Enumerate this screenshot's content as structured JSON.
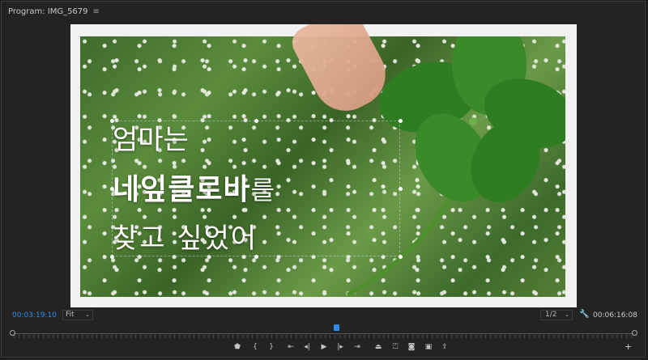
{
  "panel": {
    "title": "Program: IMG_5679",
    "menu_icon": "hamburger-menu-icon"
  },
  "viewer": {
    "title_lines": {
      "line1": "엄마는",
      "line2_bold": "네잎클로바",
      "line2_thin": "를",
      "line3": "찾고 싶었어"
    }
  },
  "controls": {
    "current_timecode": "00:03:19:10",
    "zoom_level": "Fit",
    "resolution": "1/2",
    "settings_icon": "wrench-icon",
    "duration_timecode": "00:06:16:08"
  },
  "timeline": {
    "playhead_position": 0.52
  },
  "transport": {
    "buttons": [
      {
        "name": "add-marker-icon",
        "glyph": "⬟"
      },
      {
        "name": "mark-in-icon",
        "glyph": "{"
      },
      {
        "name": "mark-out-icon",
        "glyph": "}"
      },
      {
        "name": "go-to-in-icon",
        "glyph": "⇤"
      },
      {
        "name": "step-back-icon",
        "glyph": "◂|"
      },
      {
        "name": "play-icon",
        "glyph": "▶"
      },
      {
        "name": "step-forward-icon",
        "glyph": "|▸"
      },
      {
        "name": "go-to-out-icon",
        "glyph": "⇥"
      },
      {
        "name": "lift-icon",
        "glyph": "⏏"
      },
      {
        "name": "extract-icon",
        "glyph": "⏍"
      },
      {
        "name": "export-frame-icon",
        "glyph": "◙"
      },
      {
        "name": "comparison-view-icon",
        "glyph": "▣"
      },
      {
        "name": "share-icon",
        "glyph": "⇪"
      }
    ],
    "add_button_icon": "plus-icon",
    "add_button_glyph": "+"
  },
  "colors": {
    "accent": "#2d8ceb",
    "panel_bg": "#232323",
    "letterbox": "#f1f1f1"
  }
}
